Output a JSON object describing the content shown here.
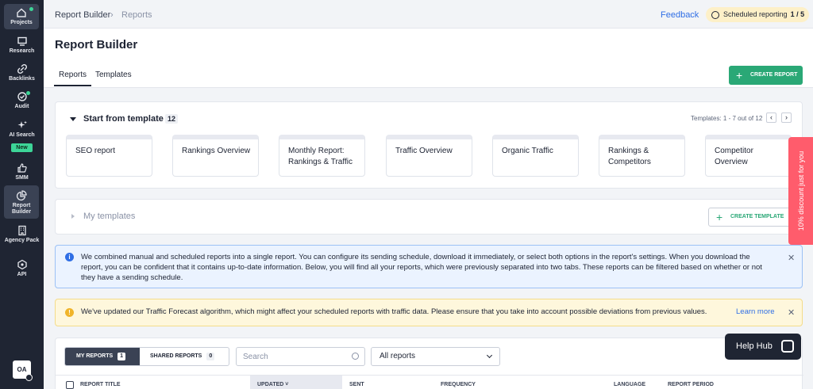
{
  "sidebar": {
    "items": [
      {
        "label": "Projects"
      },
      {
        "label": "Research"
      },
      {
        "label": "Backlinks"
      },
      {
        "label": "Audit"
      },
      {
        "label": "AI Search",
        "badge": "New"
      },
      {
        "label": "SMM"
      },
      {
        "label": "Report Builder"
      },
      {
        "label": "Agency Pack"
      },
      {
        "label": "API"
      }
    ],
    "avatar": "OA"
  },
  "topbar": {
    "breadcrumb": [
      "Report Builder",
      "Reports"
    ],
    "feedback": "Feedback",
    "scheduled_label": "Scheduled reporting",
    "scheduled_count": "1 / 5"
  },
  "header": {
    "title": "Report Builder",
    "tabs": [
      "Reports",
      "Templates"
    ],
    "create_report": "CREATE REPORT"
  },
  "templates": {
    "title": "Start from template",
    "count": "12",
    "pager": "Templates: 1 - 7 out of 12",
    "cards": [
      "SEO report",
      "Rankings Overview",
      "Monthly Report: Rankings & Traffic",
      "Traffic Overview",
      "Organic Traffic",
      "Rankings & Competitors",
      "Competitor Overview"
    ]
  },
  "my_templates": {
    "title": "My templates",
    "create_template": "CREATE TEMPLATE"
  },
  "discount": "10% discount just for you",
  "info_alert": "We combined manual and scheduled reports into a single report. You can configure its sending schedule, download it immediately, or select both options in the report's settings. When you download the report, you can be confident that it contains up-to-date information. Below, you will find all your reports, which were previously separated into two tabs. These reports can be filtered based on whether or not they have a sending schedule.",
  "warn_alert": {
    "text": "We've updated our Traffic Forecast algorithm, which might affect your scheduled reports with traffic data. Please ensure that you take into account possible deviations from previous values.",
    "link": "Learn more"
  },
  "reports": {
    "my_reports": "MY REPORTS",
    "my_count": "1",
    "shared_reports": "SHARED REPORTS",
    "shared_count": "0",
    "search_placeholder": "Search",
    "filter": "All reports",
    "columns": [
      "REPORT TITLE",
      "UPDATED",
      "SENT",
      "FREQUENCY",
      "LANGUAGE",
      "REPORT PERIOD"
    ]
  },
  "help_hub": "Help Hub",
  "colors": {
    "accent": "#2aa876",
    "sidebar": "#1f2533",
    "link": "#2f6ee5",
    "discount": "#ff5c6c"
  }
}
